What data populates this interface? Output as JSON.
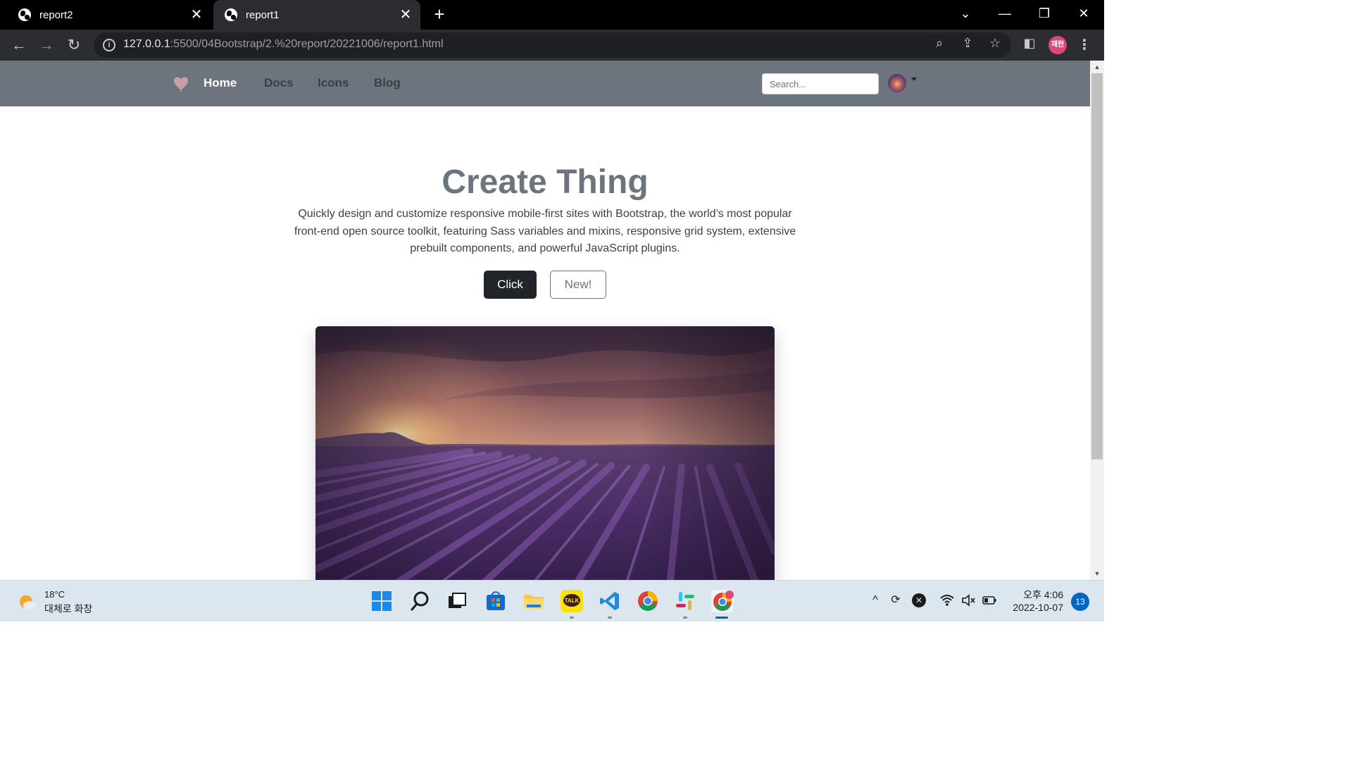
{
  "browser": {
    "tabs": [
      {
        "title": "report2",
        "active": false
      },
      {
        "title": "report1",
        "active": true
      }
    ],
    "url_host": "127.0.0.1",
    "url_rest": ":5500/04Bootstrap/2.%20report/20221006/report1.html",
    "profile_label": "재란"
  },
  "site": {
    "nav": {
      "links": [
        "Home",
        "Docs",
        "Icons",
        "Blog"
      ],
      "search_placeholder": "Search..."
    },
    "hero": {
      "title": "Create Thing",
      "lead": "Quickly design and customize responsive mobile-first sites with Bootstrap, the world’s most popular front-end open source toolkit, featuring Sass variables and mixins, responsive grid system, extensive prebuilt components, and powerful JavaScript plugins.",
      "primary_button": "Click",
      "secondary_button": "New!"
    },
    "colors": {
      "navbar": "#6c757d",
      "title": "#6c757d",
      "btn_dark": "#212529"
    }
  },
  "taskbar": {
    "weather_temp": "18°C",
    "weather_desc": "대체로 화창",
    "time": "오후 4:06",
    "date": "2022-10-07",
    "notification_count": "13",
    "apps": [
      "start-icon",
      "search-icon",
      "task-view-icon",
      "store-icon",
      "file-explorer-icon",
      "kakaotalk-icon",
      "vscode-icon",
      "chrome-icon",
      "slack-icon",
      "chrome-profile-icon"
    ],
    "kakaotalk_label": "TALK"
  }
}
